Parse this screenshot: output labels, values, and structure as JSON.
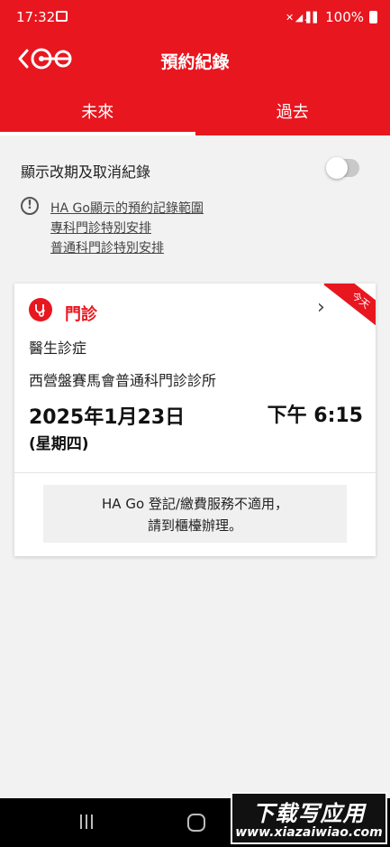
{
  "status_bar": {
    "time": "17:32",
    "battery": "100%",
    "signal_glyphs": "✕ ◢ .▌▌"
  },
  "header": {
    "title": "預約紀錄",
    "icons": [
      "back-icon",
      "ha-go-logo-icon"
    ]
  },
  "tabs": [
    {
      "label": "未來",
      "active": true
    },
    {
      "label": "過去",
      "active": false
    }
  ],
  "toggle": {
    "label": "顯示改期及取消紀錄",
    "on": false
  },
  "info": {
    "icon": "info-icon",
    "icon_glyph": "!",
    "links": [
      "HA Go顯示的預約記錄範圍",
      "專科門診特別安排",
      "普通科門診特別安排"
    ]
  },
  "appointment": {
    "type": "門診",
    "ribbon": "今天",
    "subtype": "醫生診症",
    "clinic": "西營盤賽馬會普通科門診診所",
    "date": "2025年1月23日",
    "weekday": "(星期四)",
    "time": "下午 6:15",
    "notice_line1": "HA Go 登記/繳費服務不適用，",
    "notice_line2": "請到櫃檯辦理。"
  },
  "watermark": {
    "main": "下载写应用",
    "url": "www.xiazaiwiao.com"
  },
  "colors": {
    "brand_red": "#e8161f",
    "background": "#f2f2f2"
  }
}
